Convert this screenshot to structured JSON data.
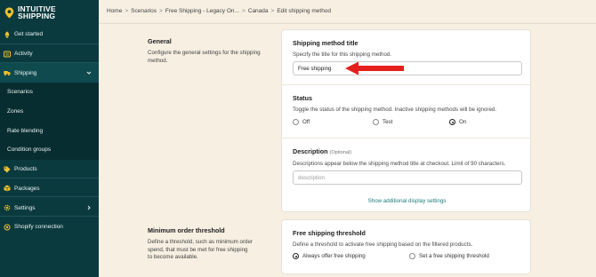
{
  "brand": {
    "line1": "INTUITIVE",
    "line2": "SHIPPING",
    "pin_color": "#f2c12e"
  },
  "sidebar": {
    "items": [
      {
        "label": "Get started",
        "icon": "rocket-icon"
      },
      {
        "label": "Activity",
        "icon": "list-icon"
      },
      {
        "label": "Shipping",
        "icon": "truck-icon"
      },
      {
        "label": "Scenarios"
      },
      {
        "label": "Zones"
      },
      {
        "label": "Rate blending"
      },
      {
        "label": "Condition groups"
      },
      {
        "label": "Products",
        "icon": "tag-icon"
      },
      {
        "label": "Packages",
        "icon": "box-icon"
      },
      {
        "label": "Settings",
        "icon": "gear-icon"
      },
      {
        "label": "Shopify connection",
        "icon": "link-icon"
      }
    ]
  },
  "breadcrumb": [
    "Home",
    "Scenarios",
    "Free Shipping - Legacy On...",
    "Canada",
    "Edit shipping method"
  ],
  "breadcrumb_sep": ">",
  "general": {
    "title": "General",
    "desc": "Configure the general settings for the shipping method."
  },
  "method_title": {
    "title": "Shipping method title",
    "desc": "Specify the title for this shipping method.",
    "value": "Free shipping"
  },
  "status": {
    "title": "Status",
    "desc": "Toggle the status of the shipping method. Inactive shipping methods will be ignored.",
    "options": [
      "Off",
      "Test",
      "On"
    ],
    "selected": "On"
  },
  "description": {
    "title": "Description",
    "optional": "(Optional)",
    "desc": "Descriptions appear below the shipping method title at checkout. Limit of 90 characters.",
    "placeholder": "description",
    "link": "Show additional display settings"
  },
  "min_order": {
    "title": "Minimum order threshold",
    "desc": "Define a threshold, such as minimum order spend, that must be met for free shipping to become available."
  },
  "free_threshold": {
    "title": "Free shipping threshold",
    "desc": "Define a threshold to activate free shipping based on the filtered products.",
    "options": [
      "Always offer free shipping",
      "Set a free shipping threshold"
    ],
    "selected": "Always offer free shipping"
  },
  "colors": {
    "sidebar_bg": "#0b3a3e",
    "page_bg": "#f6efe2",
    "accent": "#1c7a7a",
    "arrow": "#e5201c"
  }
}
